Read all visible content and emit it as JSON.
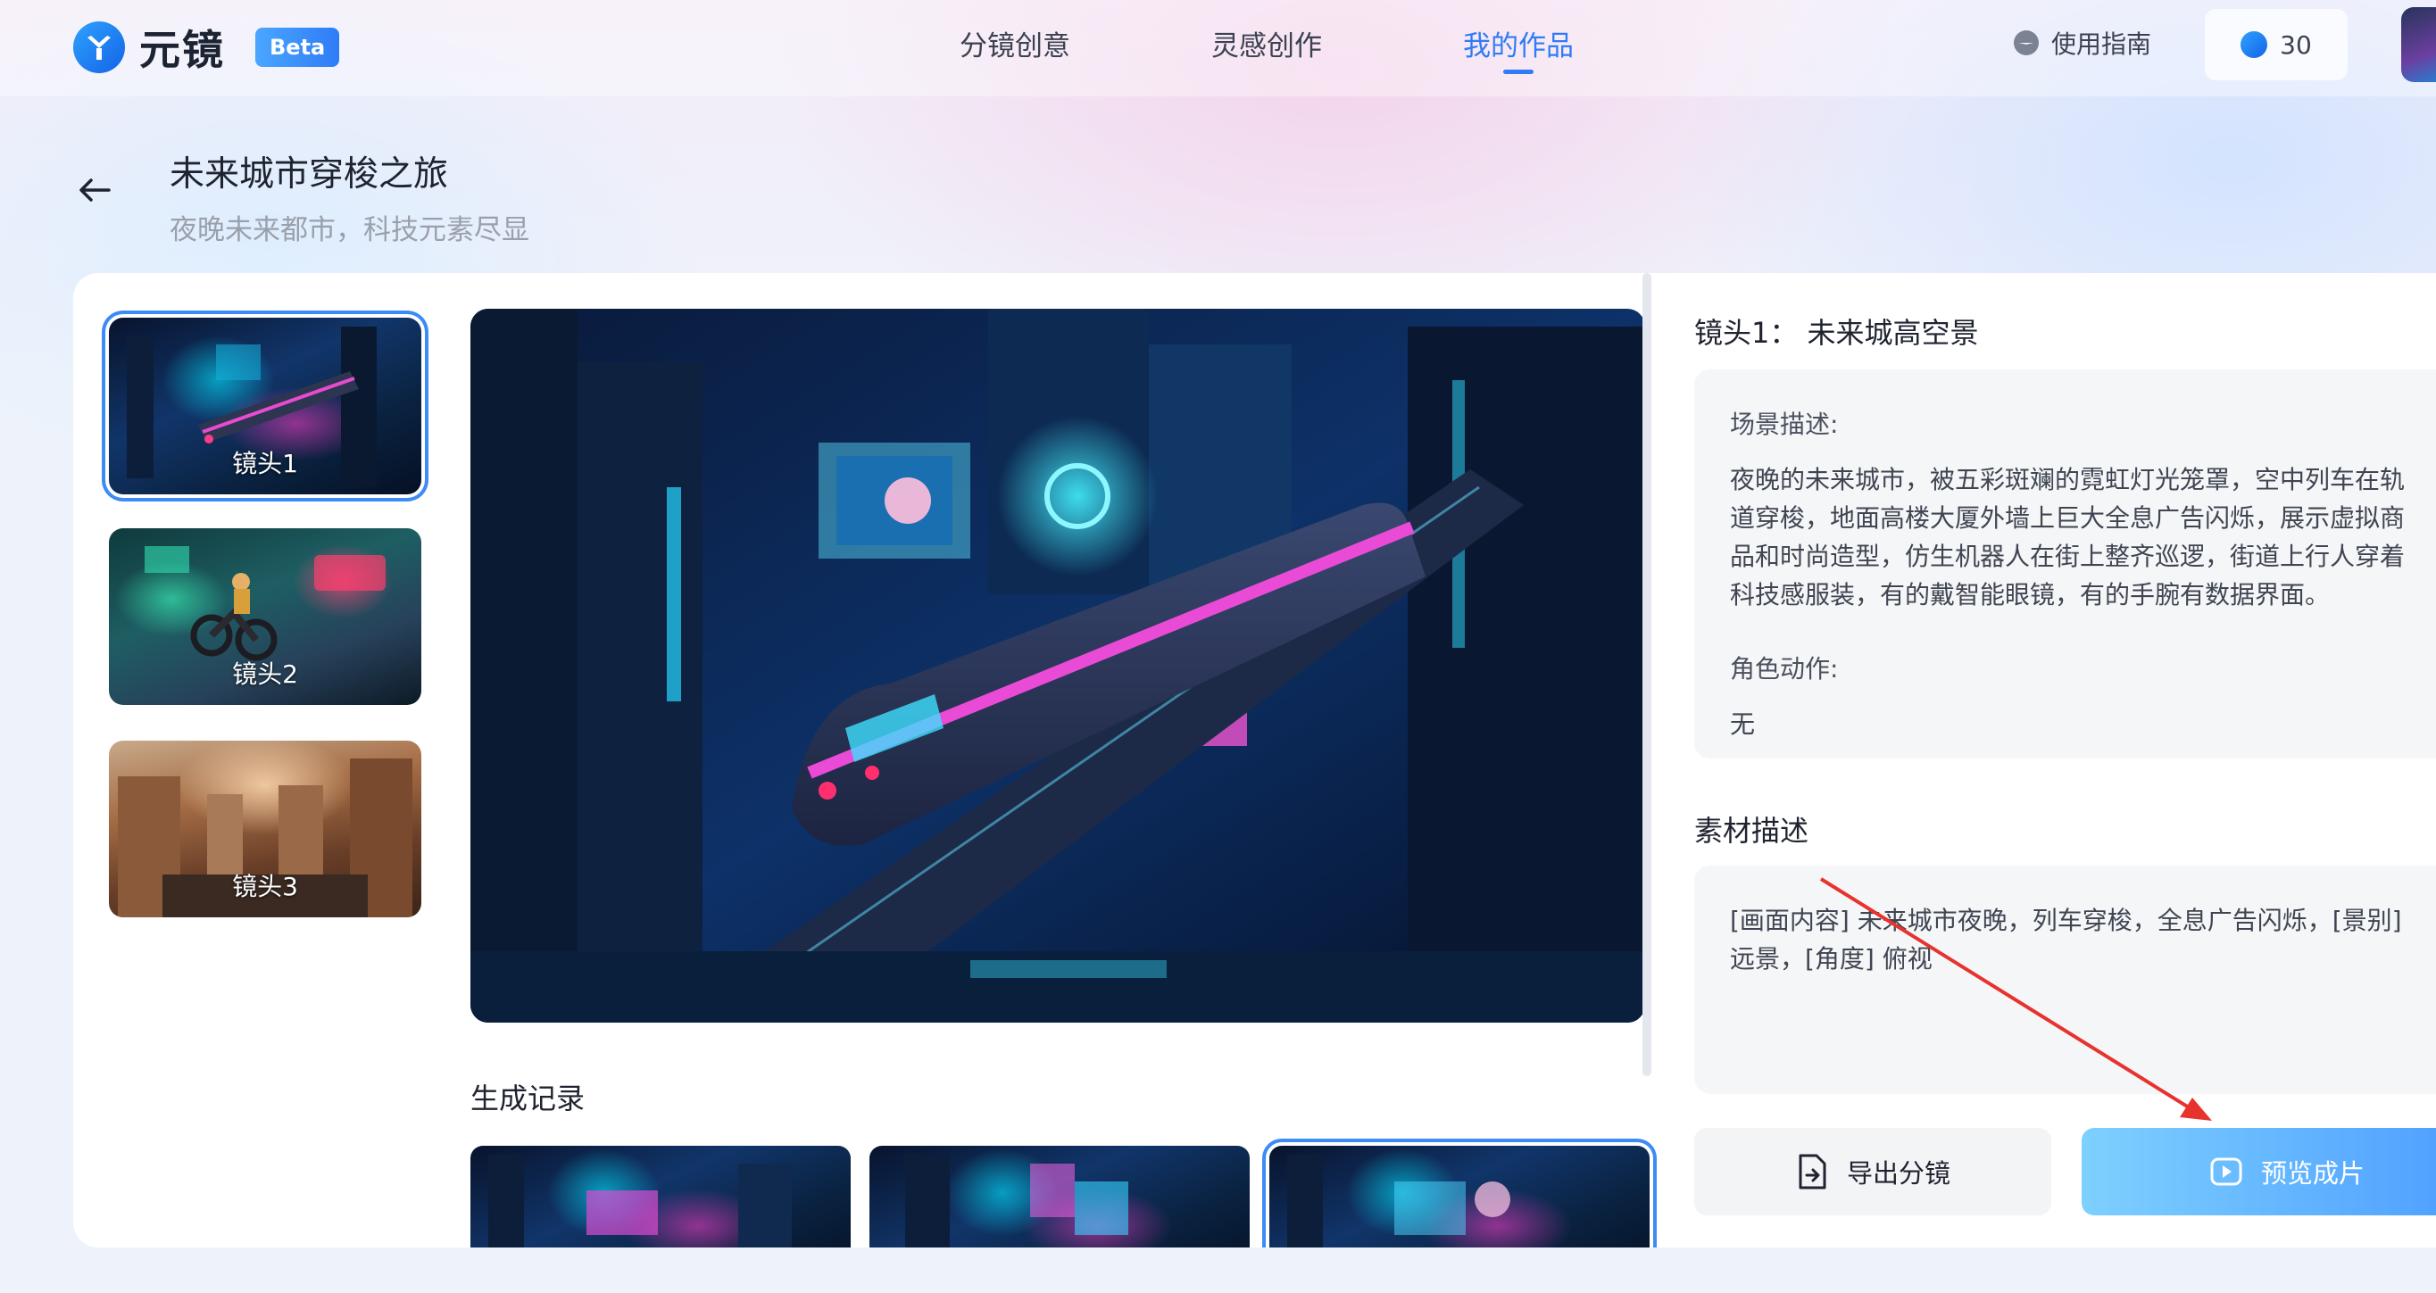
{
  "app": {
    "name": "元镜",
    "badge": "Beta"
  },
  "nav": {
    "tabs": [
      {
        "label": "分镜创意"
      },
      {
        "label": "灵感创作"
      },
      {
        "label": "我的作品"
      }
    ],
    "active_tab": "我的作品",
    "guide_label": "使用指南",
    "credits": "30"
  },
  "project": {
    "title": "未来城市穿梭之旅",
    "subtitle": "夜晚未来都市，科技元素尽显"
  },
  "shots": [
    {
      "label": "镜头1",
      "selected": true
    },
    {
      "label": "镜头2",
      "selected": false
    },
    {
      "label": "镜头3",
      "selected": false
    }
  ],
  "generation": {
    "title": "生成记录",
    "selected_index": 2
  },
  "detail": {
    "shot_heading": "镜头1： 未来城高空景",
    "scene_label": "场景描述:",
    "scene_text": "夜晚的未来城市，被五彩斑斓的霓虹灯光笼罩，空中列车在轨道穿梭，地面高楼大厦外墙上巨大全息广告闪烁，展示虚拟商品和时尚造型，仿生机器人在街上整齐巡逻，街道上行人穿着科技感服装，有的戴智能眼镜，有的手腕有数据界面。",
    "action_label": "角色动作:",
    "action_text": "无",
    "material_heading": "素材描述",
    "material_text": "[画面内容] 未来城市夜晚，列车穿梭，全息广告闪烁，[景别] 远景，[角度] 俯视"
  },
  "buttons": {
    "export": "导出分镜",
    "preview": "预览成片"
  },
  "colors": {
    "accent": "#2f7cf6",
    "annotation_arrow": "#e8322e"
  }
}
